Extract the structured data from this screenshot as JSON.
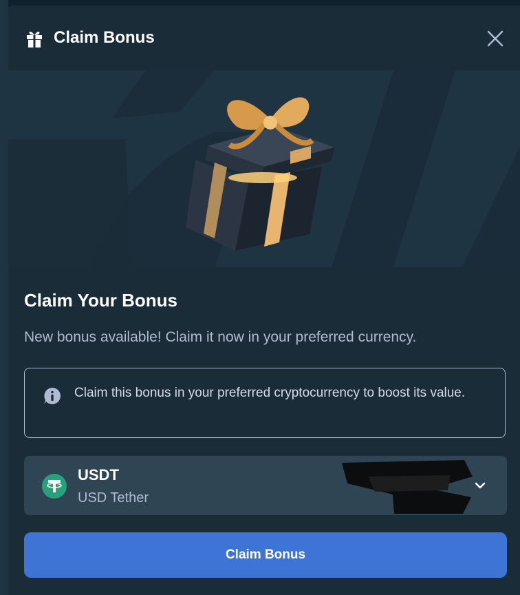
{
  "modal": {
    "title": "Claim Bonus",
    "header_icon": "gift-icon",
    "close_icon": "close-icon"
  },
  "hero": {
    "image": "gift-box-illustration"
  },
  "content": {
    "heading": "Claim Your Bonus",
    "subtext": "New bonus available! Claim it now in your preferred currency.",
    "notice": {
      "icon": "info-icon",
      "text": "Claim this bonus in your preferred cryptocurrency to boost its value."
    },
    "currency": {
      "code": "USDT",
      "name": "USD Tether",
      "icon": "tether-icon",
      "dropdown_icon": "chevron-down-icon"
    },
    "claim_button_label": "Claim Bonus"
  },
  "colors": {
    "background": "#1a2c38",
    "hero": "#1f3443",
    "select": "#2f4553",
    "button": "#3e74d6",
    "tether": "#26a17b",
    "muted_text": "#b1bad3"
  }
}
